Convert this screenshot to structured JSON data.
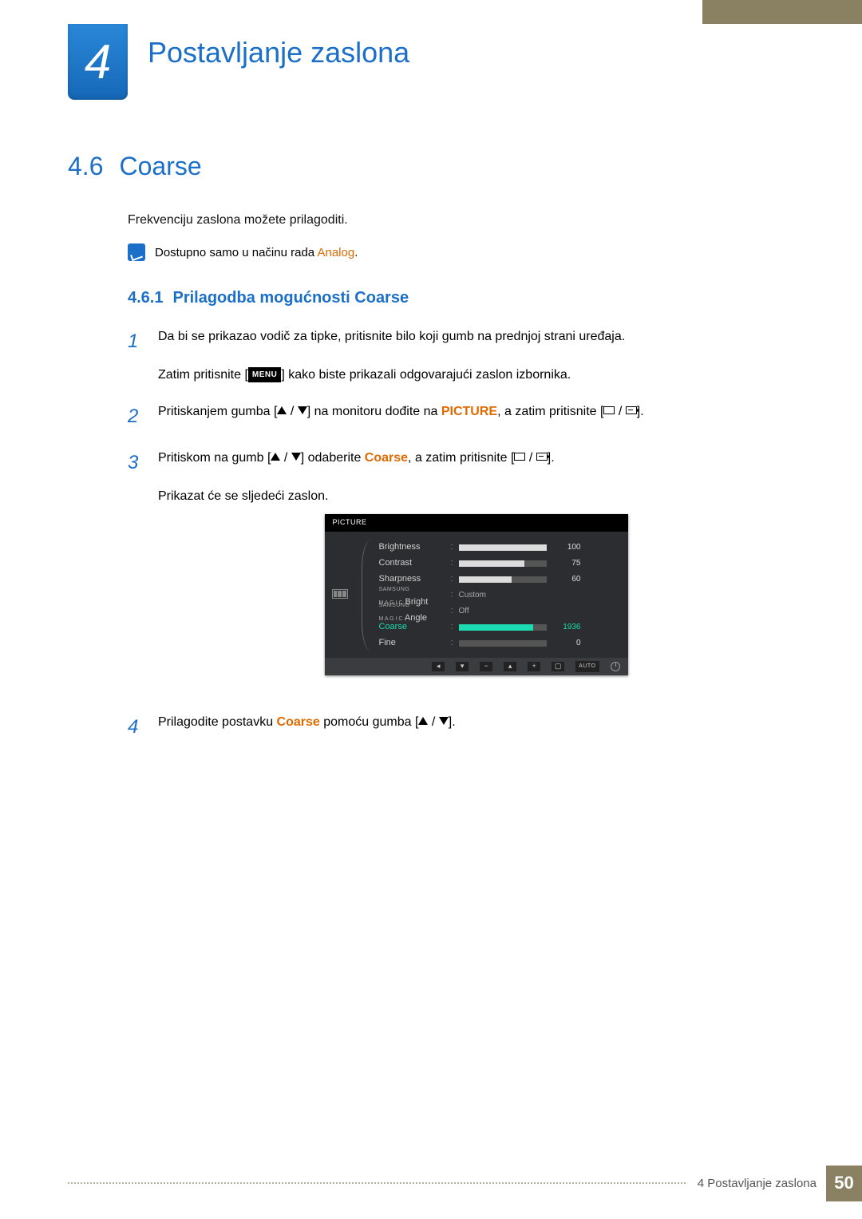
{
  "chapter": {
    "number": "4",
    "title": "Postavljanje zaslona"
  },
  "section": {
    "number": "4.6",
    "title": "Coarse"
  },
  "intro": "Frekvenciju zaslona možete prilagoditi.",
  "note": {
    "prefix": "Dostupno samo u načinu rada ",
    "mode": "Analog",
    "suffix": "."
  },
  "subsection": {
    "number": "4.6.1",
    "title": "Prilagodba mogućnosti Coarse"
  },
  "steps": {
    "s1a": "Da bi se prikazao vodič za tipke, pritisnite bilo koji gumb na prednjoj strani uređaja.",
    "s1b_prefix": "Zatim pritisnite [",
    "s1b_menu": "MENU",
    "s1b_suffix": "] kako biste prikazali odgovarajući zaslon izbornika.",
    "s2_prefix": "Pritiskanjem gumba [",
    "s2_mid": "] na monitoru dođite na ",
    "s2_target": "PICTURE",
    "s2_suffix": ", a zatim pritisnite [",
    "s2_end": "].",
    "s3_prefix": "Pritiskom na gumb [",
    "s3_mid": "] odaberite ",
    "s3_target": "Coarse",
    "s3_suffix": ", a zatim pritisnite [",
    "s3_end": "].",
    "s3_after": "Prikazat će se sljedeći zaslon.",
    "s4_prefix": "Prilagodite postavku ",
    "s4_target": "Coarse",
    "s4_mid": " pomoću gumba [",
    "s4_end": "]."
  },
  "osd": {
    "title": "PICTURE",
    "rows": [
      {
        "label": "Brightness",
        "value": "100",
        "pct": 100
      },
      {
        "label": "Contrast",
        "value": "75",
        "pct": 75
      },
      {
        "label": "Sharpness",
        "value": "60",
        "pct": 60
      },
      {
        "label": "Bright",
        "text": "Custom",
        "magic": true
      },
      {
        "label": "Angle",
        "text": "Off",
        "magic": true
      },
      {
        "label": "Coarse",
        "value": "1936",
        "pct": 85,
        "active": true
      },
      {
        "label": "Fine",
        "value": "0",
        "pct": 0
      }
    ],
    "auto": "AUTO"
  },
  "footer": {
    "label": "4 Postavljanje zaslona",
    "page": "50"
  }
}
